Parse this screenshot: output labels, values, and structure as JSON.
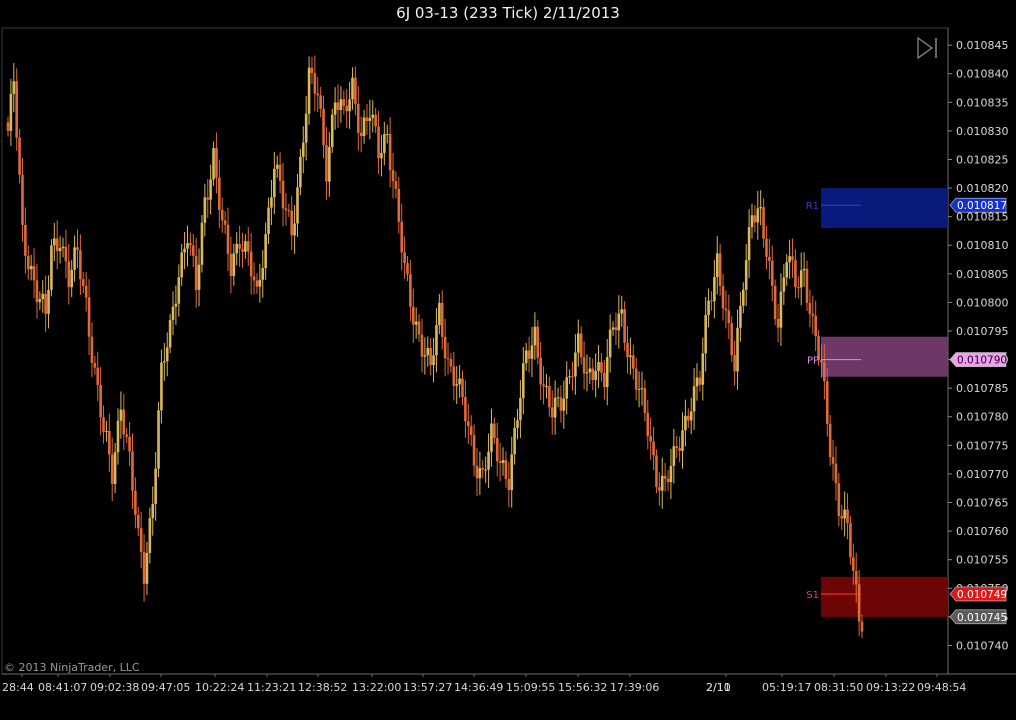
{
  "window": {
    "title": "6J 03-13 (233 Tick)  2/11/2013"
  },
  "copyright": "© 2013 NinjaTrader, LLC",
  "colors": {
    "background": "#000000",
    "up_bar": "#d9b95a",
    "down_bar": "#e06a3a",
    "r1_zone": "#0b1d8a",
    "pp_zone": "#7b3c73",
    "s1_zone": "#7a0606",
    "r1_text": "#2f3fd0",
    "pp_text": "#e08ce0",
    "s1_text": "#ff3a3a",
    "last_price_flag": "#5a5a5a"
  },
  "icons": {
    "scroll_end": "scroll-to-end-icon"
  },
  "chart_data": {
    "type": "candlestick",
    "title": "6J 03-13 (233 Tick)  2/11/2013",
    "ylim": [
      0.010735,
      0.010848
    ],
    "y_ticks": [
      "0.010740",
      "0.010745",
      "0.010750",
      "0.010755",
      "0.010760",
      "0.010765",
      "0.010770",
      "0.010775",
      "0.010780",
      "0.010785",
      "0.010790",
      "0.010795",
      "0.010800",
      "0.010805",
      "0.010810",
      "0.010815",
      "0.010820",
      "0.010825",
      "0.010830",
      "0.010835",
      "0.010840",
      "0.010845"
    ],
    "x_ticks": [
      "28:44",
      "08:41:07",
      "09:02:38",
      "09:47:05",
      "10:22:24",
      "11:23:21",
      "12:38:52",
      "13:22:00",
      "13:57:27",
      "14:36:49",
      "15:09:55",
      "15:56:32",
      "17:39:06",
      "2/11",
      "2/10",
      "05:19:17",
      "08:31:50",
      "09:13:22",
      "09:48:54"
    ],
    "path_keypoints": [
      {
        "i": 0,
        "p": 0.01083
      },
      {
        "i": 2,
        "p": 0.010838
      },
      {
        "i": 5,
        "p": 0.010812
      },
      {
        "i": 8,
        "p": 0.010806
      },
      {
        "i": 10,
        "p": 0.010802
      },
      {
        "i": 13,
        "p": 0.010797
      },
      {
        "i": 15,
        "p": 0.010809
      },
      {
        "i": 18,
        "p": 0.010812
      },
      {
        "i": 21,
        "p": 0.010804
      },
      {
        "i": 24,
        "p": 0.010808
      },
      {
        "i": 27,
        "p": 0.0108
      },
      {
        "i": 30,
        "p": 0.010788
      },
      {
        "i": 33,
        "p": 0.010777
      },
      {
        "i": 36,
        "p": 0.01077
      },
      {
        "i": 39,
        "p": 0.010783
      },
      {
        "i": 42,
        "p": 0.010772
      },
      {
        "i": 45,
        "p": 0.010758
      },
      {
        "i": 47,
        "p": 0.010753
      },
      {
        "i": 50,
        "p": 0.010766
      },
      {
        "i": 53,
        "p": 0.010787
      },
      {
        "i": 56,
        "p": 0.010795
      },
      {
        "i": 59,
        "p": 0.010806
      },
      {
        "i": 62,
        "p": 0.010812
      },
      {
        "i": 65,
        "p": 0.010802
      },
      {
        "i": 68,
        "p": 0.010818
      },
      {
        "i": 71,
        "p": 0.010826
      },
      {
        "i": 74,
        "p": 0.010813
      },
      {
        "i": 77,
        "p": 0.010806
      },
      {
        "i": 80,
        "p": 0.010812
      },
      {
        "i": 83,
        "p": 0.010808
      },
      {
        "i": 86,
        "p": 0.0108
      },
      {
        "i": 89,
        "p": 0.010812
      },
      {
        "i": 92,
        "p": 0.010825
      },
      {
        "i": 95,
        "p": 0.010817
      },
      {
        "i": 98,
        "p": 0.010812
      },
      {
        "i": 101,
        "p": 0.010825
      },
      {
        "i": 104,
        "p": 0.010839
      },
      {
        "i": 107,
        "p": 0.010836
      },
      {
        "i": 110,
        "p": 0.010824
      },
      {
        "i": 113,
        "p": 0.010836
      },
      {
        "i": 116,
        "p": 0.010832
      },
      {
        "i": 119,
        "p": 0.010838
      },
      {
        "i": 122,
        "p": 0.01083
      },
      {
        "i": 125,
        "p": 0.010833
      },
      {
        "i": 128,
        "p": 0.010826
      },
      {
        "i": 131,
        "p": 0.01083
      },
      {
        "i": 134,
        "p": 0.010818
      },
      {
        "i": 137,
        "p": 0.010805
      },
      {
        "i": 140,
        "p": 0.010798
      },
      {
        "i": 143,
        "p": 0.010793
      },
      {
        "i": 146,
        "p": 0.010788
      },
      {
        "i": 149,
        "p": 0.010798
      },
      {
        "i": 152,
        "p": 0.01079
      },
      {
        "i": 155,
        "p": 0.010786
      },
      {
        "i": 158,
        "p": 0.01078
      },
      {
        "i": 161,
        "p": 0.010773
      },
      {
        "i": 164,
        "p": 0.01077
      },
      {
        "i": 167,
        "p": 0.010776
      },
      {
        "i": 170,
        "p": 0.010772
      },
      {
        "i": 173,
        "p": 0.01077
      },
      {
        "i": 176,
        "p": 0.01078
      },
      {
        "i": 179,
        "p": 0.01079
      },
      {
        "i": 182,
        "p": 0.010795
      },
      {
        "i": 185,
        "p": 0.010785
      },
      {
        "i": 188,
        "p": 0.01078
      },
      {
        "i": 191,
        "p": 0.010783
      },
      {
        "i": 194,
        "p": 0.010788
      },
      {
        "i": 197,
        "p": 0.010792
      },
      {
        "i": 200,
        "p": 0.010786
      },
      {
        "i": 203,
        "p": 0.01079
      },
      {
        "i": 206,
        "p": 0.010787
      },
      {
        "i": 209,
        "p": 0.010795
      },
      {
        "i": 212,
        "p": 0.010798
      },
      {
        "i": 215,
        "p": 0.01079
      },
      {
        "i": 218,
        "p": 0.010784
      },
      {
        "i": 221,
        "p": 0.010778
      },
      {
        "i": 224,
        "p": 0.01077
      },
      {
        "i": 227,
        "p": 0.010768
      },
      {
        "i": 230,
        "p": 0.010772
      },
      {
        "i": 233,
        "p": 0.010778
      },
      {
        "i": 236,
        "p": 0.010783
      },
      {
        "i": 239,
        "p": 0.010786
      },
      {
        "i": 242,
        "p": 0.0108
      },
      {
        "i": 245,
        "p": 0.010808
      },
      {
        "i": 248,
        "p": 0.010797
      },
      {
        "i": 251,
        "p": 0.010788
      },
      {
        "i": 254,
        "p": 0.010805
      },
      {
        "i": 257,
        "p": 0.010816
      },
      {
        "i": 260,
        "p": 0.010814
      },
      {
        "i": 263,
        "p": 0.010806
      },
      {
        "i": 266,
        "p": 0.010797
      },
      {
        "i": 269,
        "p": 0.010808
      },
      {
        "i": 272,
        "p": 0.010803
      },
      {
        "i": 275,
        "p": 0.010806
      },
      {
        "i": 278,
        "p": 0.010796
      },
      {
        "i": 281,
        "p": 0.010788
      },
      {
        "i": 284,
        "p": 0.010775
      },
      {
        "i": 287,
        "p": 0.010765
      },
      {
        "i": 290,
        "p": 0.01076
      },
      {
        "i": 292,
        "p": 0.010752
      },
      {
        "i": 294,
        "p": 0.010745
      },
      {
        "i": 295,
        "p": 0.010745
      }
    ],
    "pivot_levels": [
      {
        "name": "R1",
        "value": 0.010817,
        "label": "0.010817",
        "zone": [
          0.010813,
          0.01082
        ]
      },
      {
        "name": "PP",
        "value": 0.01079,
        "label": "0.010790",
        "zone": [
          0.010787,
          0.010794
        ]
      },
      {
        "name": "S1",
        "value": 0.010749,
        "label": "0.010749",
        "zone": [
          0.010745,
          0.010752
        ]
      }
    ],
    "last_price": {
      "value": 0.010745,
      "label": "0.010745"
    },
    "grid": false
  }
}
